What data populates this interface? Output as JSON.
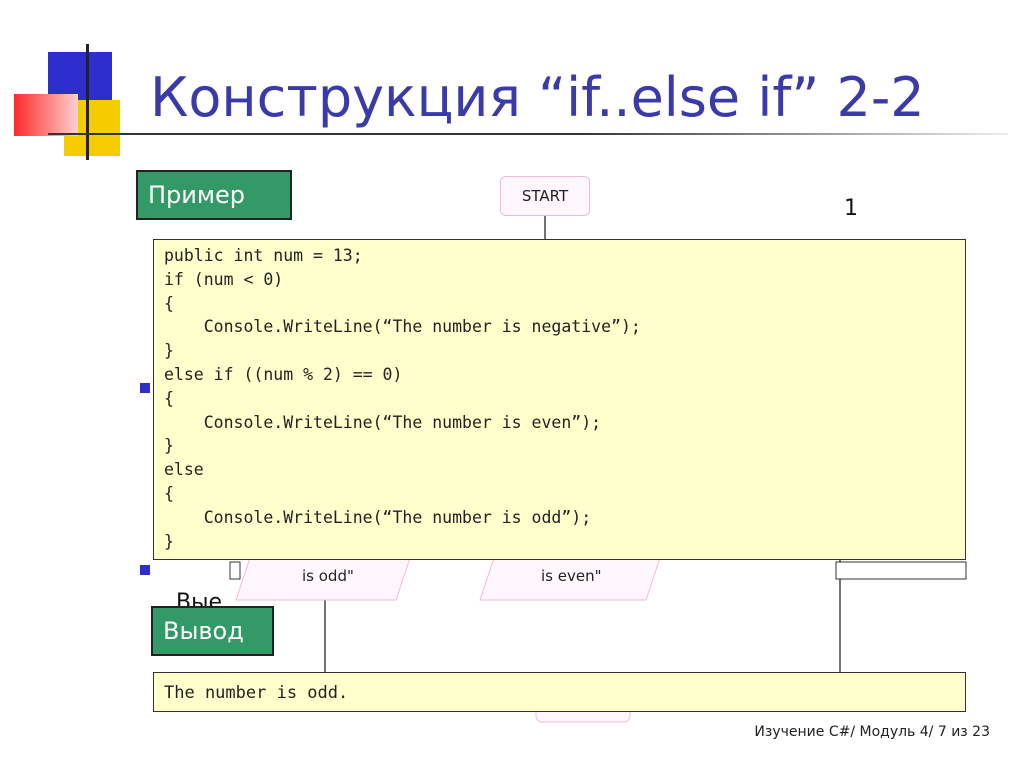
{
  "title": "Конструкция “if..else if” 2-2",
  "example_label": "Пример",
  "output_label": "Вывод",
  "flowchart": {
    "start": "START",
    "right_fragment": "1",
    "odd_box": "is odd\"",
    "even_box": "is even\"",
    "partial_text": "Вые"
  },
  "code": [
    "public int num = 13;",
    "if (num < 0)",
    "{",
    "    Console.WriteLine(“The number is negative”);",
    "}",
    "else if ((num % 2) == 0)",
    "{",
    "    Console.WriteLine(“The number is even”);",
    "}",
    "else",
    "{",
    "    Console.WriteLine(“The number is odd”);",
    "}"
  ],
  "output": "The number is odd.",
  "footer": "Изучение C#/ Модуль 4/ 7 из 23",
  "colors": {
    "title": "#3a3aa8",
    "label_bg": "#339966",
    "code_bg": "#ffffcc",
    "bullet": "#2e2ecc"
  }
}
